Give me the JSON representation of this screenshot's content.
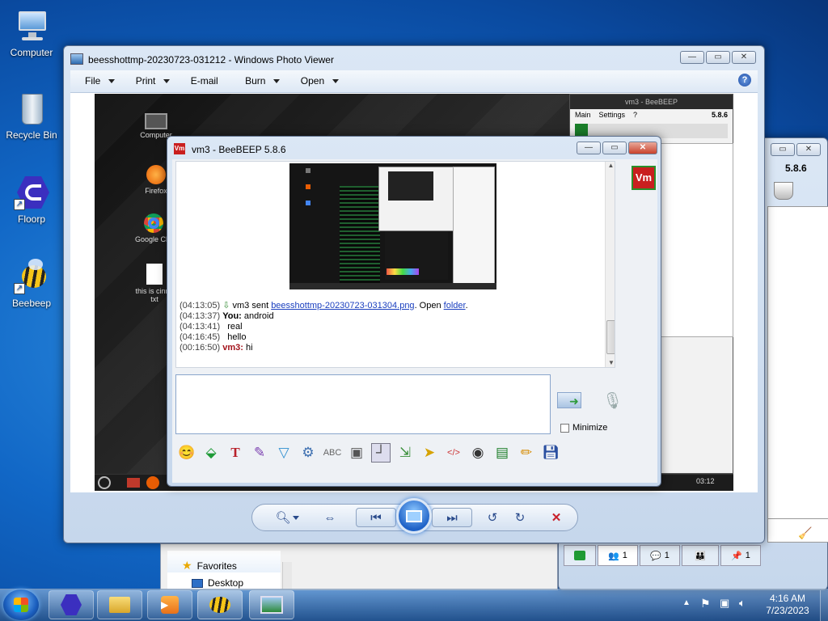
{
  "desktop": {
    "icons": [
      {
        "label": "Computer"
      },
      {
        "label": "Recycle Bin"
      },
      {
        "label": "Floorp"
      },
      {
        "label": "Beebeep"
      }
    ]
  },
  "photo_viewer": {
    "title": "beesshottmp-20230723-031212 - Windows Photo Viewer",
    "menu": [
      "File",
      "Print",
      "E-mail",
      "Burn",
      "Open"
    ],
    "help_icon": "help-icon",
    "controls": {
      "zoom": "zoom-icon",
      "fit": "fit-icon",
      "prev": "previous-icon",
      "slideshow": "slideshow-icon",
      "next": "next-icon",
      "rotate_ccw": "rotate-ccw-icon",
      "rotate_cw": "rotate-cw-icon",
      "delete": "delete-icon"
    }
  },
  "screenshot_content": {
    "icons": [
      "Computer",
      "Firefox",
      "Google Chrome",
      "this is cinnamon.txt"
    ],
    "icon_texts": {
      "computer": "Computer",
      "firefox": "Firefox",
      "chrome": "Google Chr",
      "txt1": "this is cinna",
      "txt2": "txt"
    },
    "vm_window": {
      "title": "vm3 - BeeBEEP",
      "menu": [
        "Main",
        "Settings",
        "?"
      ],
      "version": "5.8.6"
    },
    "tray_time": "03:12"
  },
  "beebeep": {
    "title": "vm3 - BeeBEEP 5.8.6",
    "avatar": "Vm",
    "messages": [
      {
        "time": "(04:13:05)",
        "sender": "vm3",
        "text_before": " sent ",
        "link": "beesshottmp-20230723-031304.png",
        "text_mid": ". Open ",
        "link2": "folder",
        "text_after": "."
      },
      {
        "time": "(04:13:37)",
        "sender": "You:",
        "text": " android"
      },
      {
        "time": "(04:13:41)",
        "text": "real"
      },
      {
        "time": "(04:16:45)",
        "text": "hello"
      },
      {
        "time": "(00:16:50)",
        "sender": "vm3:",
        "text": " hi"
      }
    ],
    "input_value": "",
    "minimize_label": "Minimize",
    "toolbar_icons": [
      "emoticon-icon",
      "send-file-icon",
      "font-icon",
      "color-icon",
      "filter-icon",
      "settings-icon",
      "spellcheck-icon",
      "word-icon",
      "quote-icon",
      "save-icon",
      "share-icon",
      "html-icon",
      "screenshot-icon",
      "terminal-icon",
      "edit-icon",
      "floppy-icon"
    ]
  },
  "back_window": {
    "version": "5.8.6",
    "tabs": [
      "1",
      "1",
      "1"
    ]
  },
  "explorer": {
    "favorites": "Favorites",
    "desktop": "Desktop"
  },
  "taskbar": {
    "time": "4:16 AM",
    "date": "7/23/2023"
  }
}
